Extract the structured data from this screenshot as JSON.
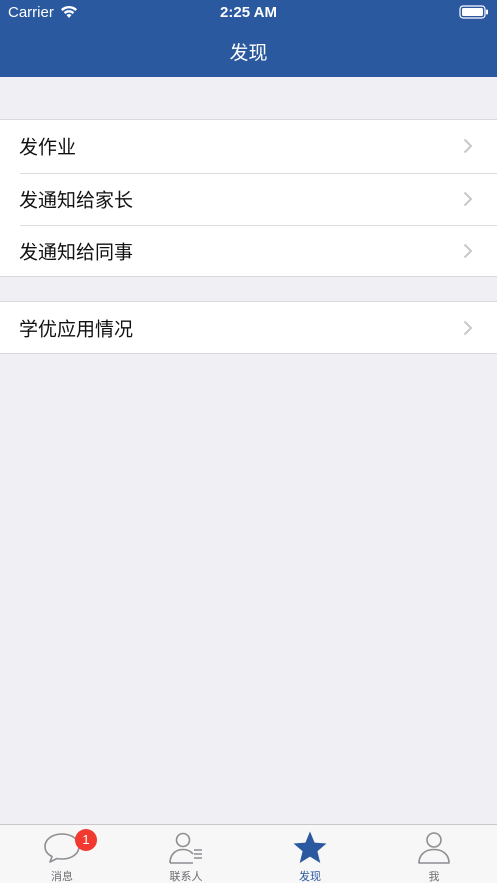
{
  "status_bar": {
    "carrier": "Carrier",
    "time": "2:25 AM",
    "wifi_icon": "wifi-icon",
    "battery_icon": "battery-icon"
  },
  "nav": {
    "title": "发现"
  },
  "groups": [
    {
      "items": [
        {
          "label": "发作业",
          "icon": "chevron-right-icon"
        },
        {
          "label": "发通知给家长",
          "icon": "chevron-right-icon"
        },
        {
          "label": "发通知给同事",
          "icon": "chevron-right-icon"
        }
      ]
    },
    {
      "items": [
        {
          "label": "学优应用情况",
          "icon": "chevron-right-icon"
        }
      ]
    }
  ],
  "tabbar": {
    "tabs": [
      {
        "label": "消息",
        "icon": "chat-bubble-icon",
        "badge": "1"
      },
      {
        "label": "联系人",
        "icon": "contacts-icon"
      },
      {
        "label": "发现",
        "icon": "star-icon",
        "selected": true
      },
      {
        "label": "我",
        "icon": "person-icon"
      }
    ]
  },
  "colors": {
    "nav_background": "#2b59a0",
    "page_background": "#efeff4",
    "tab_selected": "#2b59a0",
    "badge": "#f2392f"
  }
}
